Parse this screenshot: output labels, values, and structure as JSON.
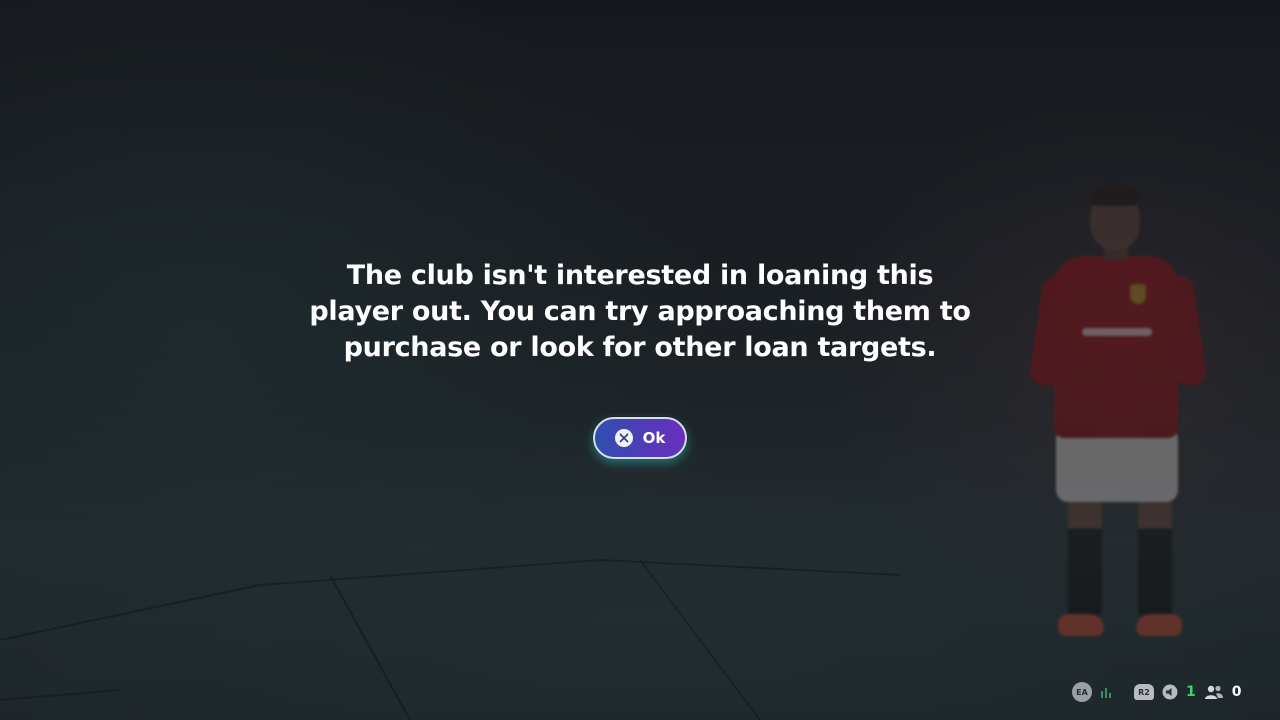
{
  "dialog": {
    "message": "The club isn't interested in loaning this player out. You can try approaching them to purchase or look for other loan targets.",
    "ok_button": {
      "label": "Ok",
      "icon": "cross-button-icon"
    }
  },
  "status_bar": {
    "ea_label": "EA",
    "r2_label": "R2",
    "active_count": "1",
    "friends_count": "0"
  },
  "colors": {
    "button_gradient_start": "#2f4fb0",
    "button_gradient_end": "#6a2fc0",
    "button_glow": "#28d2c8",
    "active_count": "#3bd66b"
  }
}
